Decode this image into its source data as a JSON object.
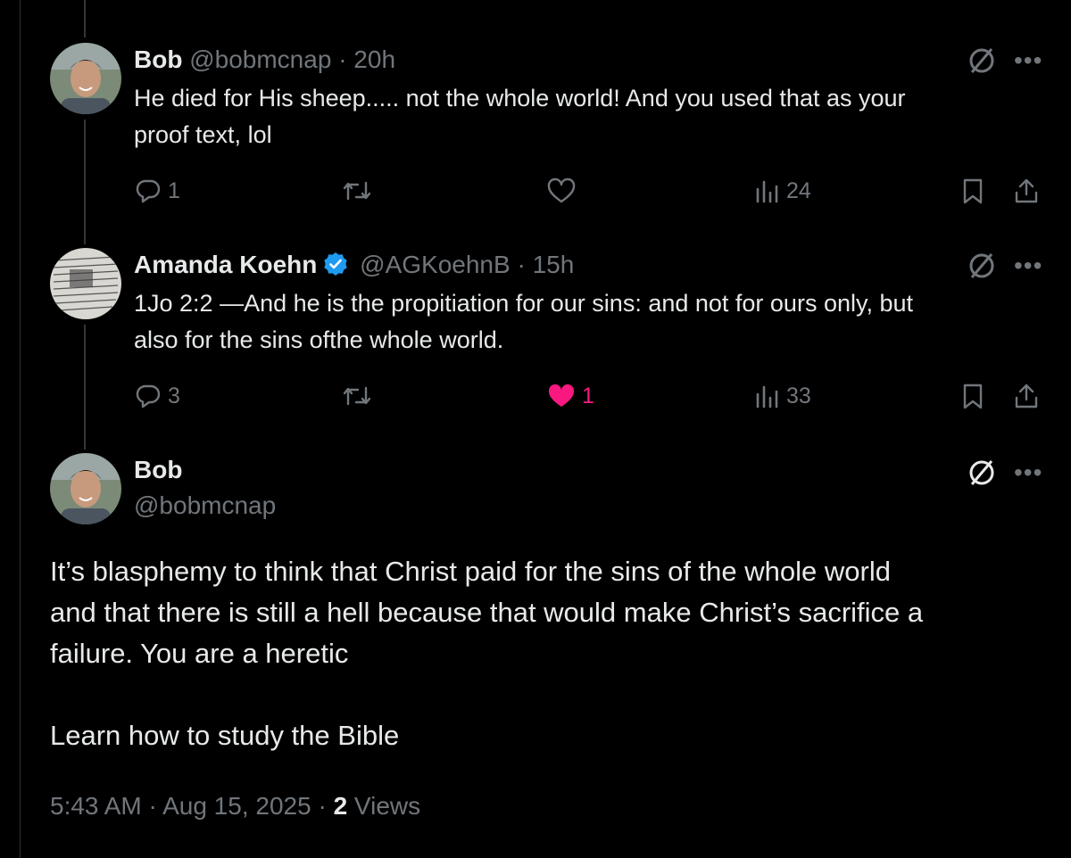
{
  "tweets": [
    {
      "name": "Bob",
      "handle": "@bobmcnap",
      "time": "20h",
      "text_line1": "He died for His sheep..... not the whole world! And you used that as your",
      "text_line2": "proof text, lol",
      "replies": "1",
      "likes": "",
      "views": "24"
    },
    {
      "name": "Amanda Koehn",
      "handle": "@AGKoehnB",
      "time": "15h",
      "text_line1": "1Jo 2:2 —And he is the propitiation for our sins: and not for ours only, but",
      "text_line2": "also for the sins ofthe whole world.",
      "replies": "3",
      "likes": "1",
      "views": "33"
    }
  ],
  "main": {
    "name": "Bob",
    "handle": "@bobmcnap",
    "para1_line1": "It’s blasphemy to think that Christ paid for the sins of the whole world",
    "para1_line2": "and that there is still a hell because that would make Christ’s sacrifice a",
    "para1_line3": "failure. You are a heretic",
    "para2": "Learn how to study the Bible",
    "time": "5:43 AM",
    "date": "Aug 15, 2025",
    "views_count": "2",
    "views_label": "Views"
  },
  "separator": "·",
  "more_glyph": "•••",
  "icons": {
    "reply": "reply-icon",
    "retweet": "retweet-icon",
    "like": "heart-icon",
    "views": "views-icon",
    "bookmark": "bookmark-icon",
    "share": "share-icon",
    "grok": "grok-icon",
    "verified": "verified-badge-icon"
  },
  "colors": {
    "background": "#000000",
    "text": "#e7e9ea",
    "muted": "#71767b",
    "like_active": "#f91880",
    "verified": "#1d9bf0"
  }
}
